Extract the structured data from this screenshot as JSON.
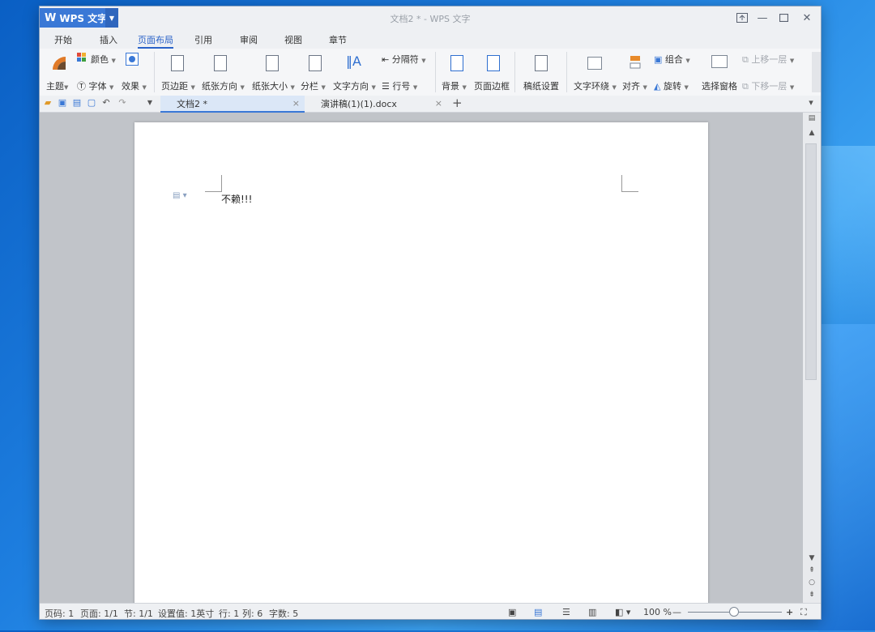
{
  "titlebar": {
    "app_label": "WPS 文字",
    "window_title": "文档2 * - WPS 文字"
  },
  "menu": {
    "items": [
      "开始",
      "插入",
      "页面布局",
      "引用",
      "审阅",
      "视图",
      "章节"
    ],
    "active": "页面布局"
  },
  "ribbon": {
    "theme": "主题",
    "color": "颜色",
    "font": "字体",
    "effect": "效果",
    "margins": "页边距",
    "orientation": "纸张方向",
    "size": "纸张大小",
    "columns": "分栏",
    "text_direction": "文字方向",
    "breaks": "分隔符",
    "line_numbers": "行号",
    "background": "背景",
    "page_border": "页面边框",
    "manuscript": "稿纸设置",
    "wrap_text": "文字环绕",
    "align": "对齐",
    "group": "组合",
    "rotate": "旋转",
    "selection_pane": "选择窗格",
    "bring_forward": "上移一层",
    "send_backward": "下移一层"
  },
  "tabs": [
    {
      "label": "文档2 *",
      "active": true
    },
    {
      "label": "演讲稿(1)(1).docx",
      "active": false
    }
  ],
  "document": {
    "text": "不赖!!!"
  },
  "status": {
    "page_code": "页码: 1",
    "pages": "页面: 1/1",
    "section": "节: 1/1",
    "setting": "设置值: 1英寸",
    "row": "行: 1",
    "col": "列: 6",
    "chars": "字数: 5",
    "zoom": "100 %"
  },
  "colors": {
    "accent": "#3a78d6",
    "window_bg": "#eef0f3",
    "workspace_bg": "#c1c4c9"
  }
}
